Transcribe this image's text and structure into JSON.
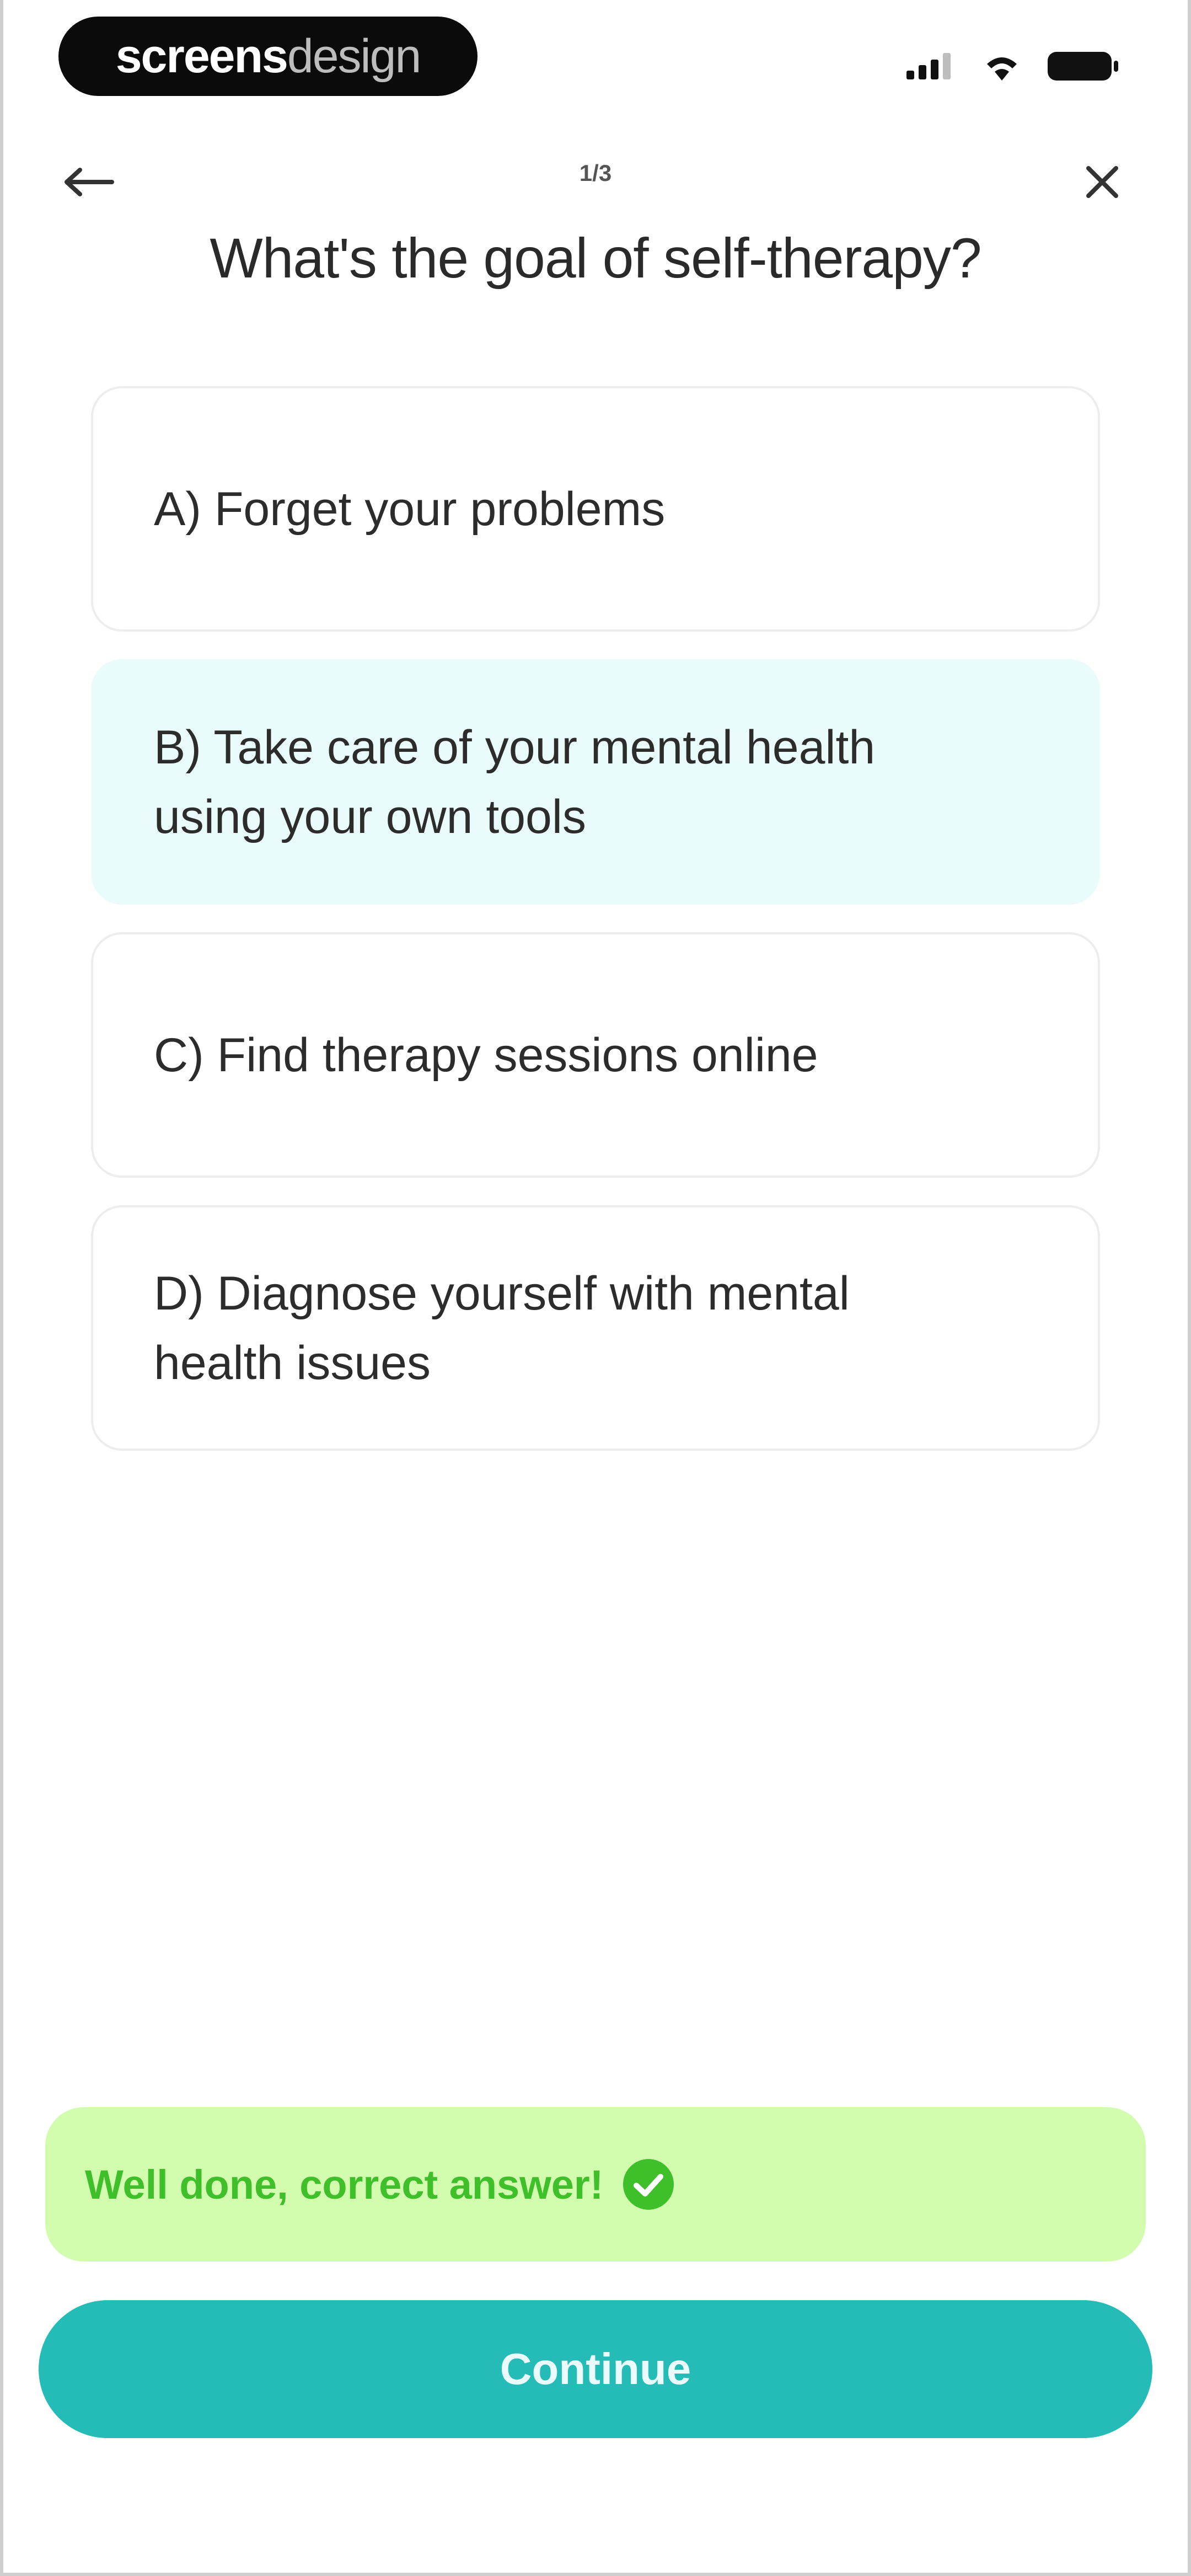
{
  "status_bar": {
    "brand_bold": "screens",
    "brand_light": "design",
    "icons": [
      "signal-icon",
      "wifi-icon",
      "battery-icon"
    ]
  },
  "header": {
    "back_icon": "arrow-left-icon",
    "progress": "1/3",
    "close_icon": "close-icon"
  },
  "question": {
    "title": "What's the goal of self-therapy?"
  },
  "options": [
    {
      "line1": "A) Forget your problems",
      "line2": ""
    },
    {
      "line1": "B) Take care of your mental health",
      "line2": "using your own tools",
      "selected": true
    },
    {
      "line1": "C) Find therapy sessions online",
      "line2": ""
    },
    {
      "line1": "D) Diagnose yourself with mental",
      "line2": "health issues"
    }
  ],
  "feedback": {
    "text": "Well done, correct answer!",
    "icon": "check-circle-icon"
  },
  "continue": {
    "label": "Continue"
  },
  "colors": {
    "accent": "#25bcb8",
    "selected_bg": "#eafbfb",
    "success_bg": "#d2fcae",
    "success_text": "#3fbf2a"
  }
}
